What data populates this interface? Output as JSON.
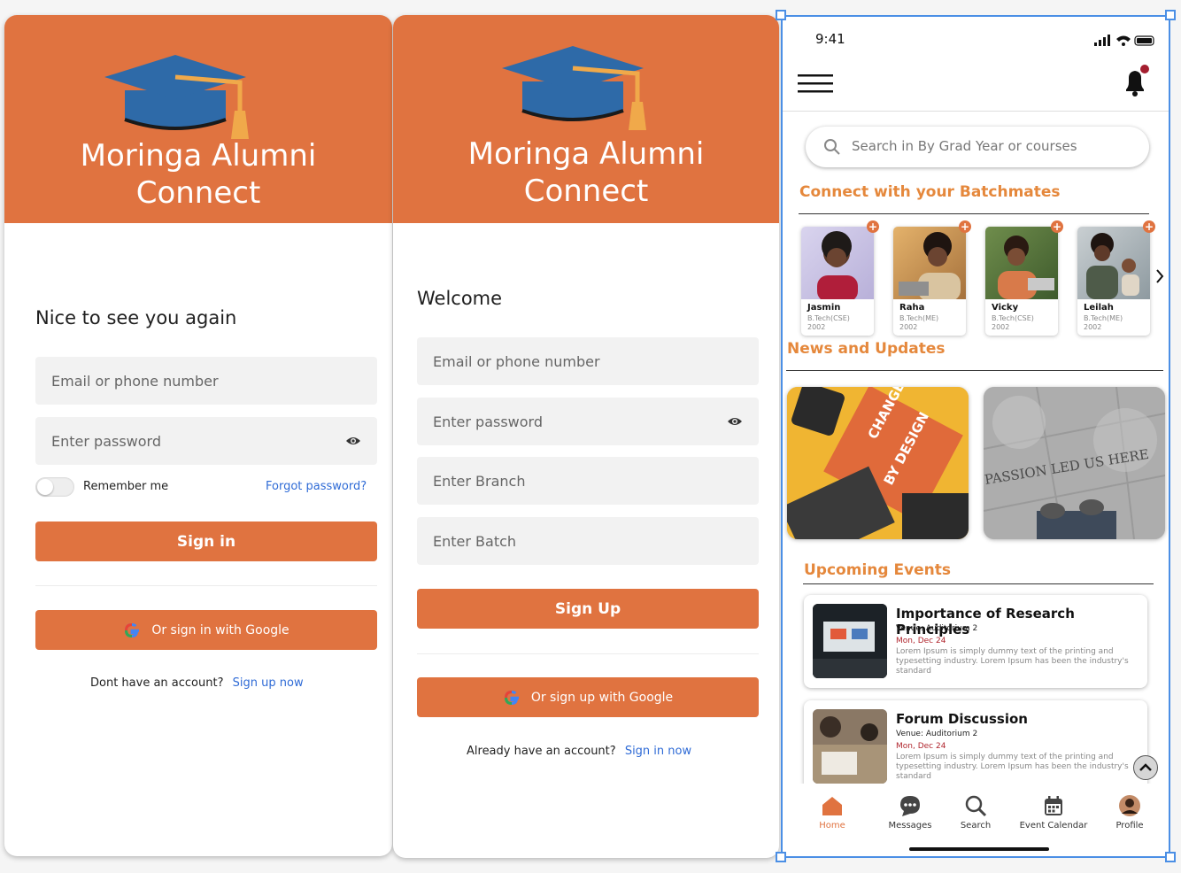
{
  "colors": {
    "brand": "#e07340",
    "accent_title": "#e5883c",
    "link": "#2f6bd6",
    "selection": "#4b8fe5"
  },
  "app_name": "Moringa Alumni Connect",
  "login": {
    "heading": "Nice to see you again",
    "email_placeholder": "Email or phone number",
    "password_placeholder": "Enter password",
    "remember": "Remember me",
    "forgot": "Forgot password?",
    "signin": "Sign in",
    "google": "Or sign in with Google",
    "no_account": "Dont have an account?",
    "signup_link": "Sign up now"
  },
  "signup": {
    "heading": "Welcome",
    "email_placeholder": "Email or phone number",
    "password_placeholder": "Enter password",
    "branch_placeholder": "Enter Branch",
    "batch_placeholder": "Enter Batch",
    "signup": "Sign Up",
    "google": "Or sign up with Google",
    "have_account": "Already have an account?",
    "signin_link": "Sign in now"
  },
  "home": {
    "time": "9:41",
    "search_placeholder": "Search in By Grad Year or courses",
    "batchmates_title": "Connect with your Batchmates",
    "batchmates": [
      {
        "name": "Jasmin",
        "branch": "B.Tech(CSE)",
        "year": "2002"
      },
      {
        "name": "Raha",
        "branch": "B.Tech(ME)",
        "year": "2002"
      },
      {
        "name": "Vicky",
        "branch": "B.Tech(CSE)",
        "year": "2002"
      },
      {
        "name": "Leilah",
        "branch": "B.Tech(ME)",
        "year": "2002"
      }
    ],
    "news_title": "News and Updates",
    "news": [
      {
        "text_line1": "CHANGE",
        "text_line2": "BY DESIGN"
      },
      {
        "text": "PASSION LED US HERE"
      }
    ],
    "events_title": "Upcoming Events",
    "events": [
      {
        "title": "Importance of Research Principles",
        "venue": "Venue: Auditorium 2",
        "date": "Mon, Dec 24",
        "desc": "Lorem Ipsum is simply dummy text of the printing and typesetting industry. Lorem Ipsum has been the industry's standard"
      },
      {
        "title": "Forum Discussion",
        "venue": "Venue: Auditorium 2",
        "date": "Mon, Dec 24",
        "desc": "Lorem Ipsum is simply dummy text of the printing and typesetting industry. Lorem Ipsum has been the industry's standard"
      }
    ],
    "nav": [
      {
        "label": "Home",
        "icon": "home-icon"
      },
      {
        "label": "Messages",
        "icon": "chat-icon"
      },
      {
        "label": "Search",
        "icon": "search-icon"
      },
      {
        "label": "Event Calendar",
        "icon": "calendar-icon"
      },
      {
        "label": "Profile",
        "icon": "avatar-icon"
      }
    ]
  }
}
